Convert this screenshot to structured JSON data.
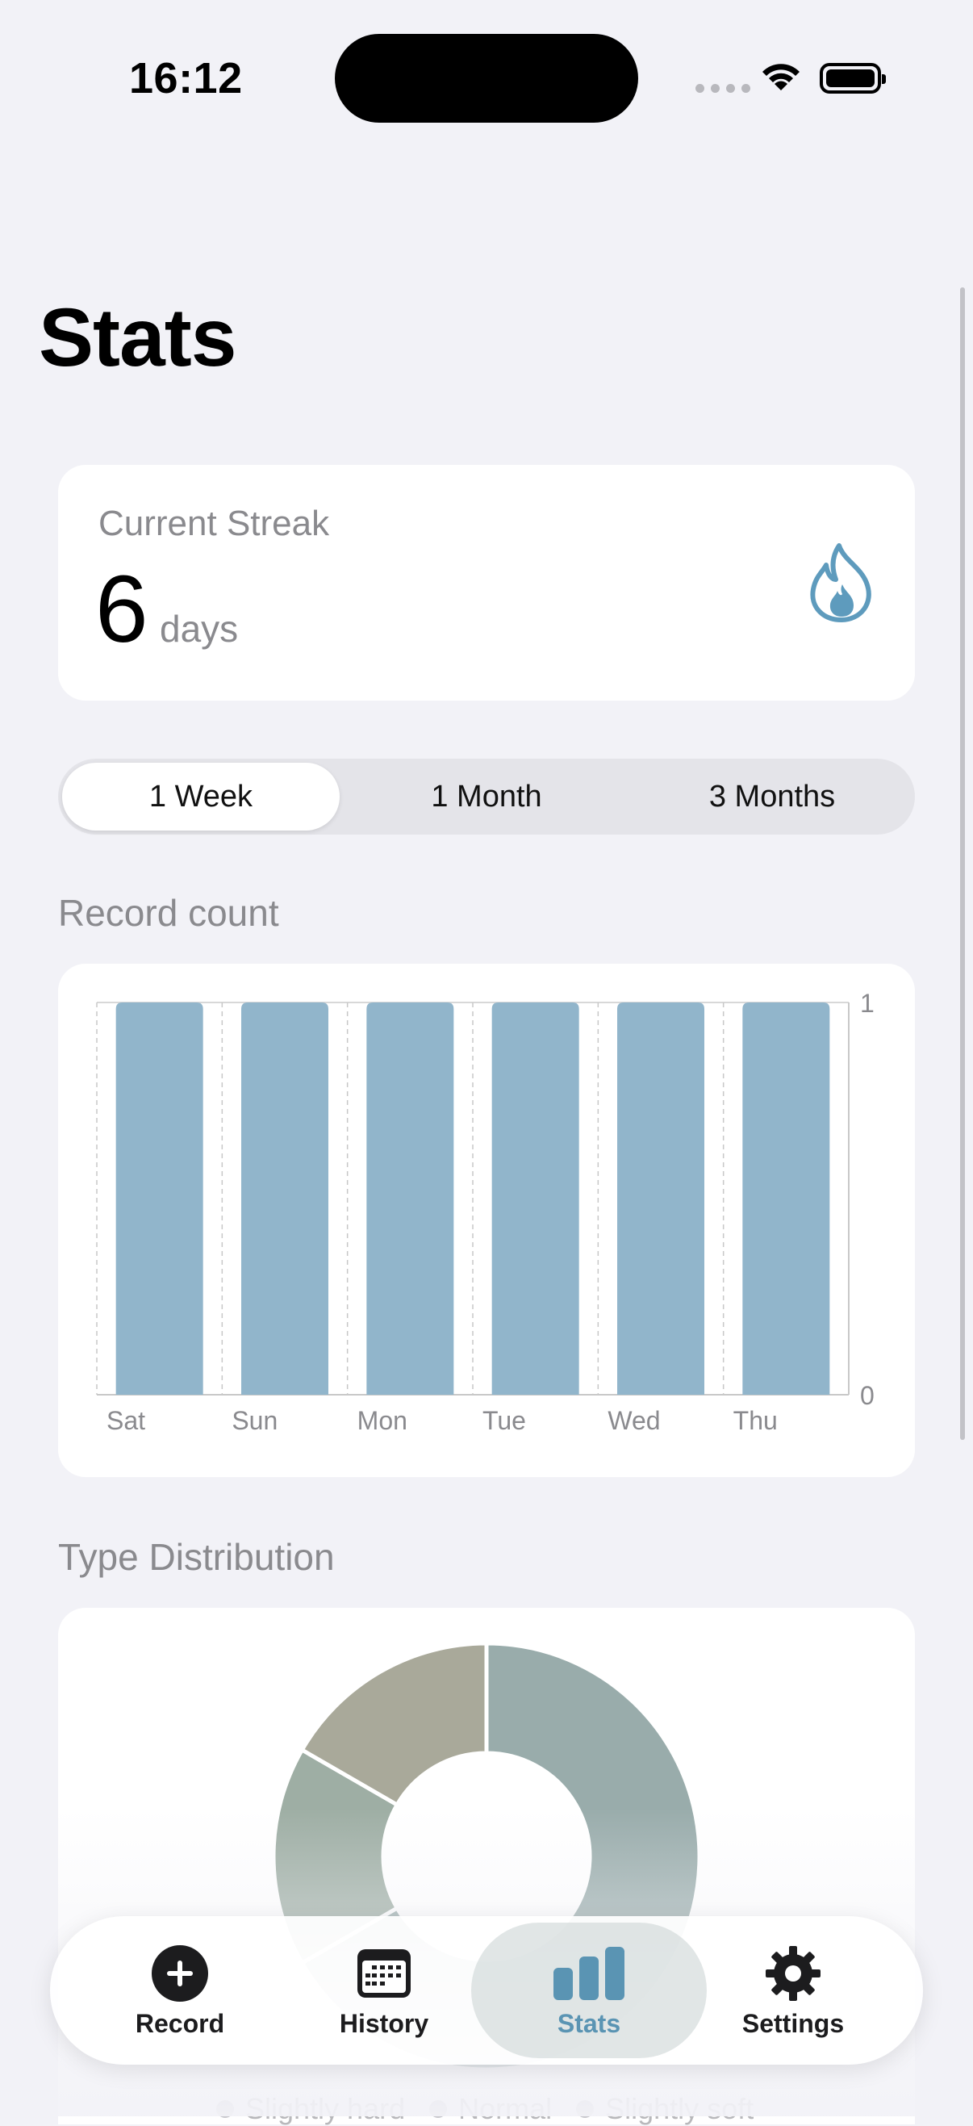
{
  "status_bar": {
    "time": "16:12"
  },
  "page": {
    "title": "Stats"
  },
  "streak": {
    "label": "Current Streak",
    "value": "6",
    "unit": "days",
    "icon": "flame-icon"
  },
  "range_selector": {
    "options": [
      "1 Week",
      "1 Month",
      "3 Months"
    ],
    "selected": "1 Week"
  },
  "record_count": {
    "section_title": "Record count"
  },
  "chart_data": [
    {
      "type": "bar",
      "title": "Record count",
      "categories": [
        "Sat",
        "Sun",
        "Mon",
        "Tue",
        "Wed",
        "Thu"
      ],
      "values": [
        1,
        1,
        1,
        1,
        1,
        1
      ],
      "ylim": [
        0,
        1
      ],
      "yticks": [
        "0",
        "1"
      ],
      "grid": true,
      "color": "#91b5cb"
    },
    {
      "type": "pie",
      "title": "Type Distribution",
      "labels": [
        "Slightly hard",
        "Normal",
        "Slightly soft"
      ],
      "values": [
        1,
        1,
        4
      ],
      "colors": [
        "#a9a99a",
        "#9eaea4",
        "#99acab"
      ]
    }
  ],
  "type_distribution": {
    "section_title": "Type Distribution",
    "legend": [
      "Slightly hard",
      "Normal",
      "Slightly soft"
    ]
  },
  "tab_bar": {
    "items": [
      {
        "label": "Record",
        "icon": "plus-circle-icon"
      },
      {
        "label": "History",
        "icon": "calendar-icon"
      },
      {
        "label": "Stats",
        "icon": "bar-chart-icon"
      },
      {
        "label": "Settings",
        "icon": "gear-icon"
      }
    ],
    "active": "Stats"
  },
  "colors": {
    "accent": "#5a94b3",
    "bar": "#91b5cb",
    "background": "#f2f2f7"
  }
}
